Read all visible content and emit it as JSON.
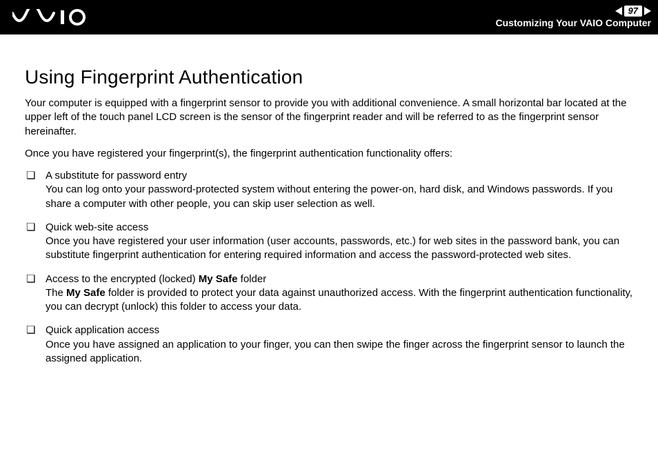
{
  "header": {
    "page_number": "97",
    "breadcrumb": "Customizing Your VAIO Computer"
  },
  "page": {
    "title": "Using Fingerprint Authentication",
    "intro1": "Your computer is equipped with a fingerprint sensor to provide you with additional convenience. A small horizontal bar located at the upper left of the touch panel LCD screen is the sensor of the fingerprint reader and will be referred to as the fingerprint sensor hereinafter.",
    "intro2": "Once you have registered your fingerprint(s), the fingerprint authentication functionality offers:"
  },
  "items": [
    {
      "title": "A substitute for password entry",
      "body": "You can log onto your password-protected system without entering the power-on, hard disk, and Windows passwords. If you share a computer with other people, you can skip user selection as well."
    },
    {
      "title": "Quick web-site access",
      "body": "Once you have registered your user information (user accounts, passwords, etc.) for web sites in the password bank, you can substitute fingerprint authentication for entering required information and access the password-protected web sites."
    },
    {
      "title_pre": "Access to the encrypted (locked) ",
      "title_bold": "My Safe",
      "title_post": " folder",
      "body_pre": "The ",
      "body_bold": "My Safe",
      "body_post": " folder is provided to protect your data against unauthorized access. With the fingerprint authentication functionality, you can decrypt (unlock) this folder to access your data."
    },
    {
      "title": "Quick application access",
      "body": "Once you have assigned an application to your finger, you can then swipe the finger across the fingerprint sensor to launch the assigned application."
    }
  ]
}
